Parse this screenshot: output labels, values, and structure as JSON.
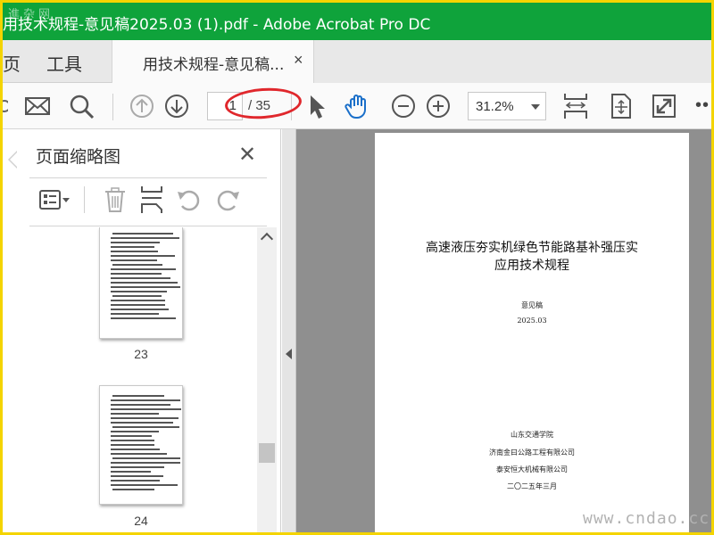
{
  "window": {
    "title": "用技术规程-意见稿2025.03 (1).pdf - Adobe Acrobat Pro DC",
    "watermark_top": "進杂网"
  },
  "tabs": {
    "home_label": "页",
    "tools_label": "工具",
    "document_tab_label": "用技术规程-意见稿...",
    "close_glyph": "×"
  },
  "toolbar": {
    "current_page": "1",
    "total_pages": "/ 35",
    "zoom": "31.2%",
    "more_glyph": "••",
    "icons": [
      "mail-icon",
      "search-icon",
      "previous-page-icon",
      "next-page-icon",
      "select-arrow-icon",
      "hand-tool-icon",
      "zoom-out-icon",
      "zoom-in-icon",
      "fit-page-icon",
      "rotate-view-icon",
      "fullscreen-icon"
    ],
    "annotation_color": "#e0272c"
  },
  "panel": {
    "title": "页面缩略图",
    "close_glyph": "✕",
    "tools": [
      "options-menu-icon",
      "delete-icon",
      "insert-page-icon",
      "rotate-left-icon",
      "rotate-right-icon"
    ],
    "thumbnails": [
      {
        "label": "23"
      },
      {
        "label": "24"
      }
    ]
  },
  "document": {
    "title_line1": "高速液压夯实机绿色节能路基补强压实",
    "title_line2": "应用技术规程",
    "draft_label": "意见稿",
    "date": "2025.03",
    "org1": "山东交通学院",
    "org2": "济南金曰公路工程有限公司",
    "org3": "泰安恒大机械有限公司",
    "issue_date": "二〇二五年三月"
  },
  "watermark": "www.cndao.cc",
  "colors": {
    "titlebar": "#0fa33b",
    "frame": "#f4d400",
    "doc_bg": "#8f8f8f"
  }
}
